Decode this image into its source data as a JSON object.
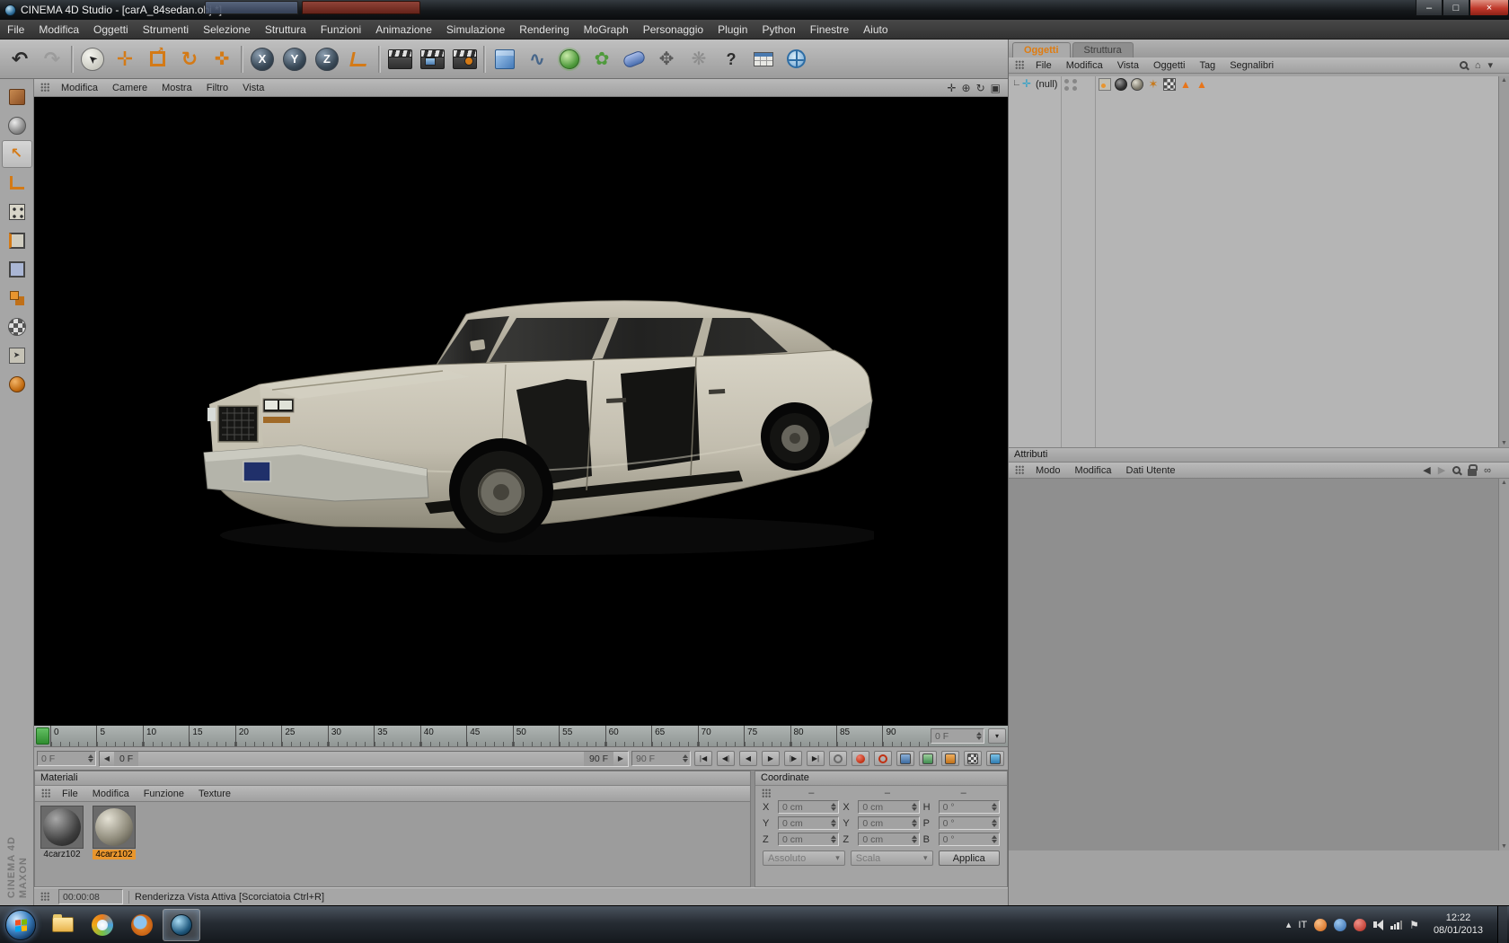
{
  "window": {
    "title": "CINEMA 4D Studio - [carA_84sedan.obj *]"
  },
  "colors": {
    "accent_orange": "#e8962e",
    "playhead_green": "#3fae3f",
    "tab_active_orange": "#e07c10"
  },
  "menubar": {
    "items": [
      "File",
      "Modifica",
      "Oggetti",
      "Strumenti",
      "Selezione",
      "Struttura",
      "Funzioni",
      "Animazione",
      "Simulazione",
      "Rendering",
      "MoGraph",
      "Personaggio",
      "Plugin",
      "Python",
      "Finestre",
      "Aiuto"
    ]
  },
  "toolbar": {
    "tools": [
      "undo",
      "redo",
      "live-selection",
      "move",
      "scale",
      "rotate",
      "last-used-tool",
      "lock-x-axis",
      "lock-y-axis",
      "lock-z-axis",
      "coordinate-system",
      "render-view",
      "render-in-picture-viewer",
      "edit-render-settings",
      "add-primitive",
      "add-spline",
      "add-generator",
      "add-modeling-object",
      "add-deformer",
      "add-particles",
      "add-simulation-object",
      "help",
      "window-layout",
      "online-browser"
    ]
  },
  "leftbar": {
    "tools": [
      "make-editable",
      "model-mode",
      "texture-mode",
      "object-axis",
      "points-mode",
      "edges-mode",
      "polygons-mode",
      "animation-mode",
      "texture-axis",
      "normal-move",
      "viewport-solo"
    ]
  },
  "viewport": {
    "menu": [
      "Modifica",
      "Camere",
      "Mostra",
      "Filtro",
      "Vista"
    ],
    "nav": [
      "pan",
      "zoom",
      "rotate",
      "maximize"
    ]
  },
  "timeline": {
    "ticks": [
      "0",
      "5",
      "10",
      "15",
      "20",
      "25",
      "30",
      "35",
      "40",
      "45",
      "50",
      "55",
      "60",
      "65",
      "70",
      "75",
      "80",
      "85",
      "90"
    ],
    "frame_box": "0 F",
    "current": "0 F",
    "range_start": "0 F",
    "range_end": "90 F",
    "end": "90 F"
  },
  "materials": {
    "title": "Materiali",
    "menu": [
      "File",
      "Modifica",
      "Funzione",
      "Texture"
    ],
    "items": [
      {
        "label": "4carz102"
      },
      {
        "label": "4carz102"
      }
    ]
  },
  "coordinates": {
    "title": "Coordinate",
    "headers": [
      "–",
      "–",
      "–"
    ],
    "position": {
      "labels": [
        "X",
        "Y",
        "Z"
      ],
      "values": [
        "0 cm",
        "0 cm",
        "0 cm"
      ]
    },
    "size": {
      "labels": [
        "X",
        "Y",
        "Z"
      ],
      "values": [
        "0 cm",
        "0 cm",
        "0 cm"
      ]
    },
    "rotation": {
      "labels": [
        "H",
        "P",
        "B"
      ],
      "values": [
        "0 °",
        "0 °",
        "0 °"
      ]
    },
    "mode": "Assoluto",
    "scale_mode": "Scala",
    "apply": "Applica"
  },
  "status": {
    "time": "00:00:08",
    "message": "Renderizza Vista Attiva [Scorciatoia Ctrl+R]"
  },
  "object_manager": {
    "tabs": [
      "Oggetti",
      "Struttura"
    ],
    "menu": [
      "File",
      "Modifica",
      "Vista",
      "Oggetti",
      "Tag",
      "Segnalibri"
    ],
    "objects": [
      {
        "name": "(null)"
      }
    ]
  },
  "attributes": {
    "title": "Attributi",
    "menu": [
      "Modo",
      "Modifica",
      "Dati Utente"
    ]
  },
  "branding": {
    "line1": "MAXON",
    "line2": "CINEMA 4D"
  },
  "taskbar": {
    "language": "IT",
    "time": "12:22",
    "date": "08/01/2013"
  }
}
